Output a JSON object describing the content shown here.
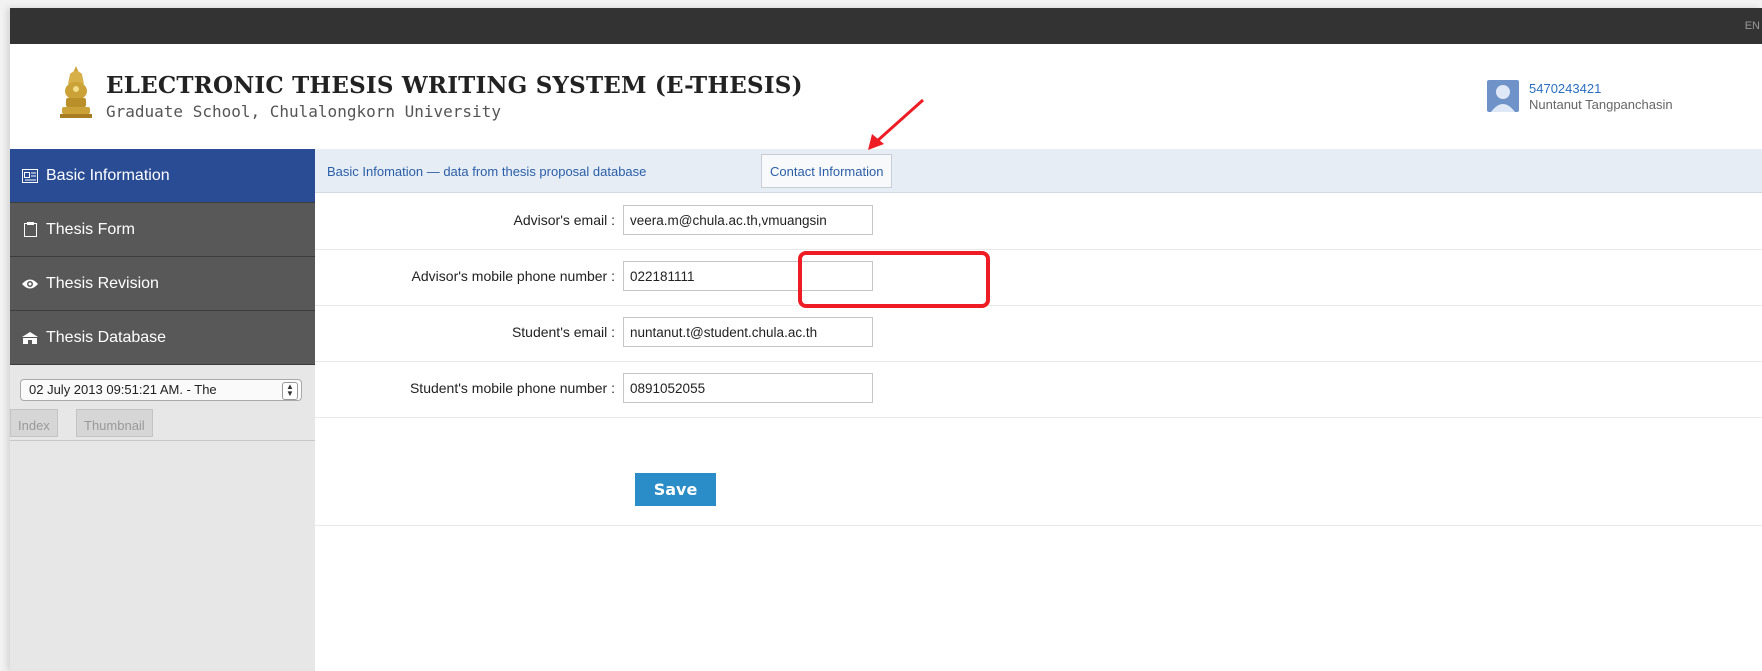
{
  "top_bar": {
    "language": "EN"
  },
  "header": {
    "title": "ELECTRONIC THESIS WRITING SYSTEM (E-THESIS)",
    "subtitle": "Graduate School, Chulalongkorn University",
    "user_id": "5470243421",
    "user_name": "Nuntanut Tangpanchasin"
  },
  "sidebar": {
    "items": [
      {
        "label": "Basic Information",
        "icon": "id-card-icon",
        "active": true
      },
      {
        "label": "Thesis Form",
        "icon": "document-icon",
        "active": false
      },
      {
        "label": "Thesis Revision",
        "icon": "eye-icon",
        "active": false
      },
      {
        "label": "Thesis Database",
        "icon": "database-icon",
        "active": false
      }
    ],
    "version_select": "02 July 2013 09:51:21 AM. - The",
    "tabs": [
      "Index",
      "Thumbnail"
    ]
  },
  "main": {
    "breadcrumb": "Basic Infomation — data from thesis proposal database",
    "contact_tab": "Contact Information",
    "fields": [
      {
        "label": "Advisor's email :",
        "value": "veera.m@chula.ac.th,vmuangsin"
      },
      {
        "label": "Advisor's mobile phone number :",
        "value": "022181111"
      },
      {
        "label": "Student's email :",
        "value": "nuntanut.t@student.chula.ac.th"
      },
      {
        "label": "Student's mobile phone number :",
        "value": "0891052055"
      }
    ],
    "save_label": "Save"
  },
  "colors": {
    "nav_active": "#294c94",
    "nav_inactive": "#585858",
    "save_button": "#2a8dc7",
    "annotation": "#ee1c25"
  }
}
